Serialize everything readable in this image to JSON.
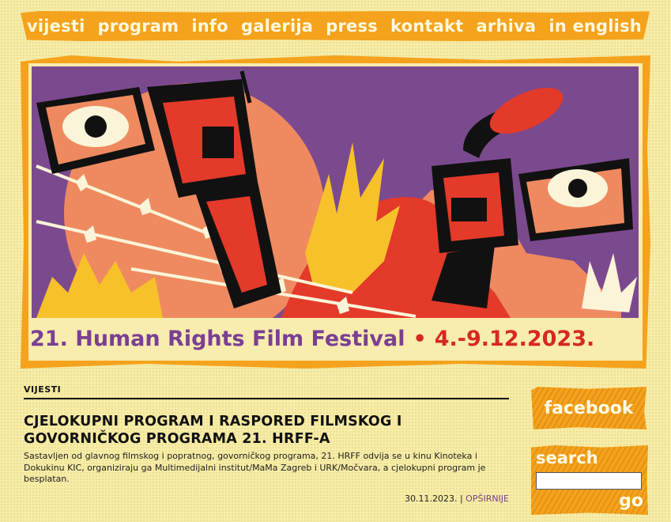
{
  "nav": {
    "items": [
      {
        "label": "vijesti"
      },
      {
        "label": "program"
      },
      {
        "label": "info"
      },
      {
        "label": "galerija"
      },
      {
        "label": "press"
      },
      {
        "label": "kontakt"
      },
      {
        "label": "arhiva"
      },
      {
        "label": "in english"
      }
    ]
  },
  "banner": {
    "festival_title": "21. Human Rights Film Festival",
    "separator": "•",
    "dates": "4.-9.12.2023."
  },
  "news": {
    "section_label": "VIJESTI",
    "headline": "CJELOKUPNI PROGRAM I RASPORED FILMSKOG I GOVORNIČKOG PROGRAMA 21. HRFF-A",
    "summary": "Sastavljen od glavnog filmskog i popratnog, govorničkog programa, 21. HRFF odvija se u kinu Kinoteka i Dokukinu KIC, organiziraju ga Multimedijalni institut/MaMa Zagreb i URK/Močvara, a cjelokupni program je besplatan.",
    "date": "30.11.2023.",
    "separator": "|",
    "more_label": "OPŠIRNIJE"
  },
  "sidebar": {
    "facebook_label": "facebook",
    "search_label": "search",
    "search_value": "",
    "go_label": "go"
  },
  "colors": {
    "background": "#f8eda6",
    "orange": "#f5a21c",
    "purple": "#7a3f93",
    "red": "#d8281f"
  }
}
